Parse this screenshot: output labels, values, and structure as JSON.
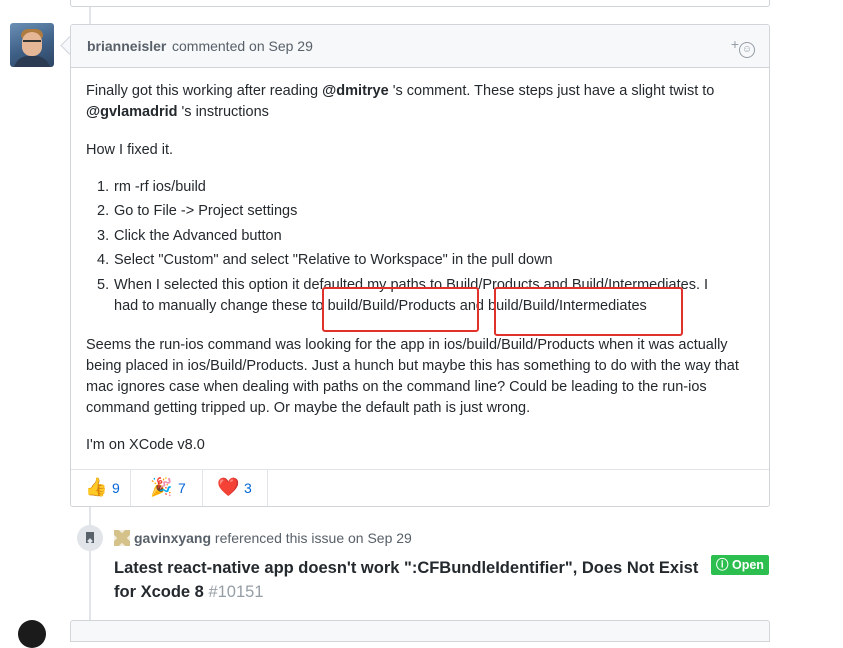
{
  "comment": {
    "author": "brianneisler",
    "action": "commented on Sep 29",
    "add_reaction": "+",
    "smile_glyph": "☺",
    "body": {
      "p1_a": "Finally got this working after reading ",
      "p1_mention1": "@dmitrye",
      "p1_b": " 's comment. These steps just have a slight twist to ",
      "p1_mention2": "@gvlamadrid",
      "p1_c": " 's instructions",
      "p2": "How I fixed it.",
      "steps": [
        {
          "num": "1.",
          "text": "rm -rf ios/build"
        },
        {
          "num": "2.",
          "text": "Go to File -> Project settings"
        },
        {
          "num": "3.",
          "text": "Click the Advanced button"
        },
        {
          "num": "4.",
          "text": "Select \"Custom\" and select \"Relative to Workspace\" in the pull down"
        },
        {
          "num": "5.",
          "text": "When I selected this option it defaulted my paths to Build/Products and Build/Intermediates. I had to manually change these to build/Build/Products and build/Build/Intermediates"
        }
      ],
      "p3": "Seems the run-ios command was looking for the app in ios/build/Build/Products when it was actually being placed in ios/Build/Products. Just a hunch but maybe this has something to do with the way that mac ignores case when dealing with paths on the command line? Could be leading to the run-ios command getting tripped up. Or maybe the default path is just wrong.",
      "p4": "I'm on XCode v8.0"
    },
    "reactions": [
      {
        "emoji": "👍",
        "icon": "thumbs-up-icon",
        "count": "9"
      },
      {
        "emoji": "🎉",
        "icon": "party-popper-icon",
        "count": "7"
      },
      {
        "emoji": "❤️",
        "icon": "heart-icon",
        "count": "3"
      }
    ]
  },
  "reference": {
    "user": "gavinxyang",
    "action": "referenced this issue on Sep 29",
    "title": "Latest react-native app doesn't work \":CFBundleIdentifier\", Does Not Exist for Xcode 8",
    "issue_number": "#10151",
    "status": "Open",
    "status_icon": "ⓘ"
  },
  "colors": {
    "annotation": "#e0312b",
    "open_badge": "#2cbe4e",
    "link": "#0366d6"
  }
}
